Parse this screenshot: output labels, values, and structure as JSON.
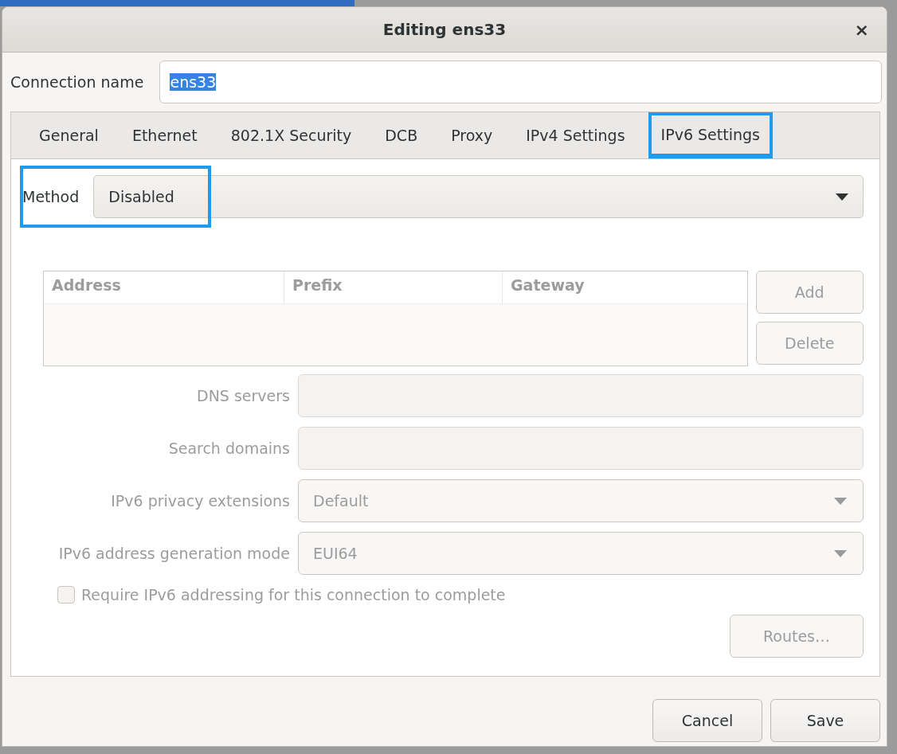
{
  "window": {
    "title": "Editing ens33",
    "close": "×"
  },
  "connection_name": {
    "label": "Connection name",
    "value": "ens33",
    "text_selected": true
  },
  "tabs": [
    {
      "label": "General",
      "selected": false
    },
    {
      "label": "Ethernet",
      "selected": false
    },
    {
      "label": "802.1X Security",
      "selected": false
    },
    {
      "label": "DCB",
      "selected": false
    },
    {
      "label": "Proxy",
      "selected": false
    },
    {
      "label": "IPv4 Settings",
      "selected": false
    },
    {
      "label": "IPv6 Settings",
      "selected": true
    }
  ],
  "method": {
    "label": "Method",
    "value": "Disabled",
    "highlighted": true
  },
  "addresses": {
    "disabled": true,
    "columns": [
      "Address",
      "Prefix",
      "Gateway"
    ],
    "buttons": [
      "Add",
      "Delete"
    ]
  },
  "fields": [
    {
      "kind": "text",
      "label": "DNS servers",
      "disabled": true
    },
    {
      "kind": "text",
      "label": "Search domains",
      "disabled": true
    },
    {
      "kind": "dropdown",
      "label": "IPv6 privacy extensions",
      "value": "Default",
      "disabled": true
    },
    {
      "kind": "dropdown",
      "label": "IPv6 address generation mode",
      "value": "EUI64",
      "disabled": true
    }
  ],
  "require_checkbox": {
    "label": "Require IPv6 addressing for this connection to complete",
    "checked": false,
    "disabled": true
  },
  "routes_button": {
    "label": "Routes…",
    "disabled": true
  },
  "buttons": [
    {
      "label": "Cancel"
    },
    {
      "label": "Save"
    }
  ]
}
